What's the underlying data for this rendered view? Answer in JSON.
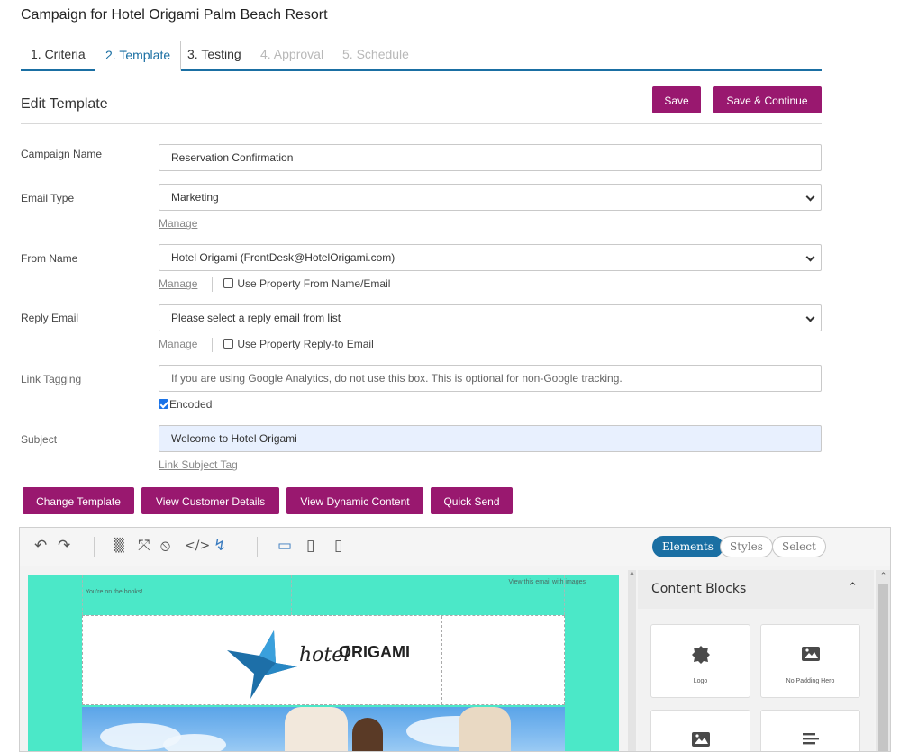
{
  "page": {
    "title": "Campaign for Hotel Origami Palm Beach Resort"
  },
  "tabs": [
    {
      "label": "1. Criteria",
      "state": "done"
    },
    {
      "label": "2. Template",
      "state": "active"
    },
    {
      "label": "3. Testing",
      "state": "done"
    },
    {
      "label": "4. Approval",
      "state": "disabled"
    },
    {
      "label": "5. Schedule",
      "state": "disabled"
    }
  ],
  "section": {
    "title": "Edit Template"
  },
  "actions": {
    "save": "Save",
    "save_continue": "Save & Continue"
  },
  "form": {
    "campaign_name": {
      "label": "Campaign Name",
      "value": "Reservation Confirmation"
    },
    "email_type": {
      "label": "Email Type",
      "value": "Marketing",
      "manage": "Manage"
    },
    "from_name": {
      "label": "From Name",
      "value": "Hotel Origami (FrontDesk@HotelOrigami.com)",
      "manage": "Manage",
      "checkbox": "Use Property From Name/Email"
    },
    "reply_email": {
      "label": "Reply Email",
      "value": "Please select a reply email from list",
      "manage": "Manage",
      "checkbox": "Use Property Reply-to Email"
    },
    "link_tagging": {
      "label": "Link Tagging",
      "placeholder": "If you are using Google Analytics, do not use this box. This is optional for non-Google tracking.",
      "checkbox": "Encoded",
      "checked": true
    },
    "subject": {
      "label": "Subject",
      "value": "Welcome to Hotel Origami",
      "link": "Link Subject Tag"
    }
  },
  "buttons": {
    "change_template": "Change Template",
    "view_customer": "View Customer Details",
    "view_dynamic": "View Dynamic Content",
    "quick_send": "Quick Send"
  },
  "editor": {
    "toolbar_icons": [
      "undo-icon",
      "redo-icon",
      "grid-icon",
      "fullscreen-icon",
      "hide-icon",
      "code-icon",
      "bolt-icon",
      "desktop-icon",
      "tablet-icon",
      "mobile-icon"
    ],
    "panel_tabs": {
      "elements": "Elements",
      "styles": "Styles",
      "select": "Select"
    },
    "preheader_left": "You're on the books!",
    "preheader_right": "View this email with images",
    "logo_text": "ORIGAMI",
    "logo_script": "hotel",
    "content_blocks": {
      "title": "Content Blocks",
      "items": [
        "Logo",
        "No Padding Hero"
      ]
    }
  },
  "colors": {
    "brand": "#99186f",
    "accent": "#1a6fa3",
    "canvas": "#4be8c8"
  }
}
